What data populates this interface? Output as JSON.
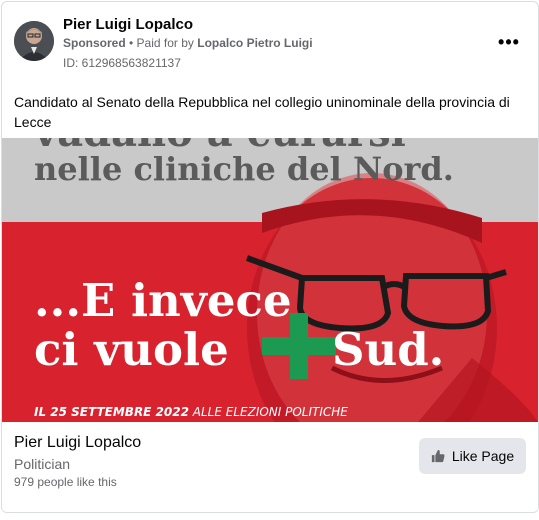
{
  "post": {
    "page_name": "Pier Luigi Lopalco",
    "sponsored": "Sponsored",
    "separator": " • ",
    "paid_for_prefix": "Paid for by ",
    "paid_for_name": "Lopalco Pietro Luigi",
    "ad_id": "ID: 612968563821137",
    "more_icon": "more-horizontal-icon",
    "body": "Candidato al Senato della Repubblica nel collegio uninominale della provincia di Lecce"
  },
  "creative": {
    "top_line_partial": "vadano a curarsi",
    "top_line": "nelle cliniche del Nord.",
    "main_line1": "...E invece",
    "main_line2_a": "ci vuole",
    "main_line2_b": "Sud.",
    "date_bold": "IL 25 SETTEMBRE 2022",
    "date_rest": " ALLE ELEZIONI POLITICHE",
    "colors": {
      "red": "#d8232f",
      "grey_band": "#c9c9c9",
      "green_plus": "#1c9a52"
    }
  },
  "cta": {
    "name": "Pier Luigi Lopalco",
    "category": "Politician",
    "likes": "979 people like this",
    "button_label": "Like Page",
    "button_icon": "thumbs-up-icon"
  }
}
